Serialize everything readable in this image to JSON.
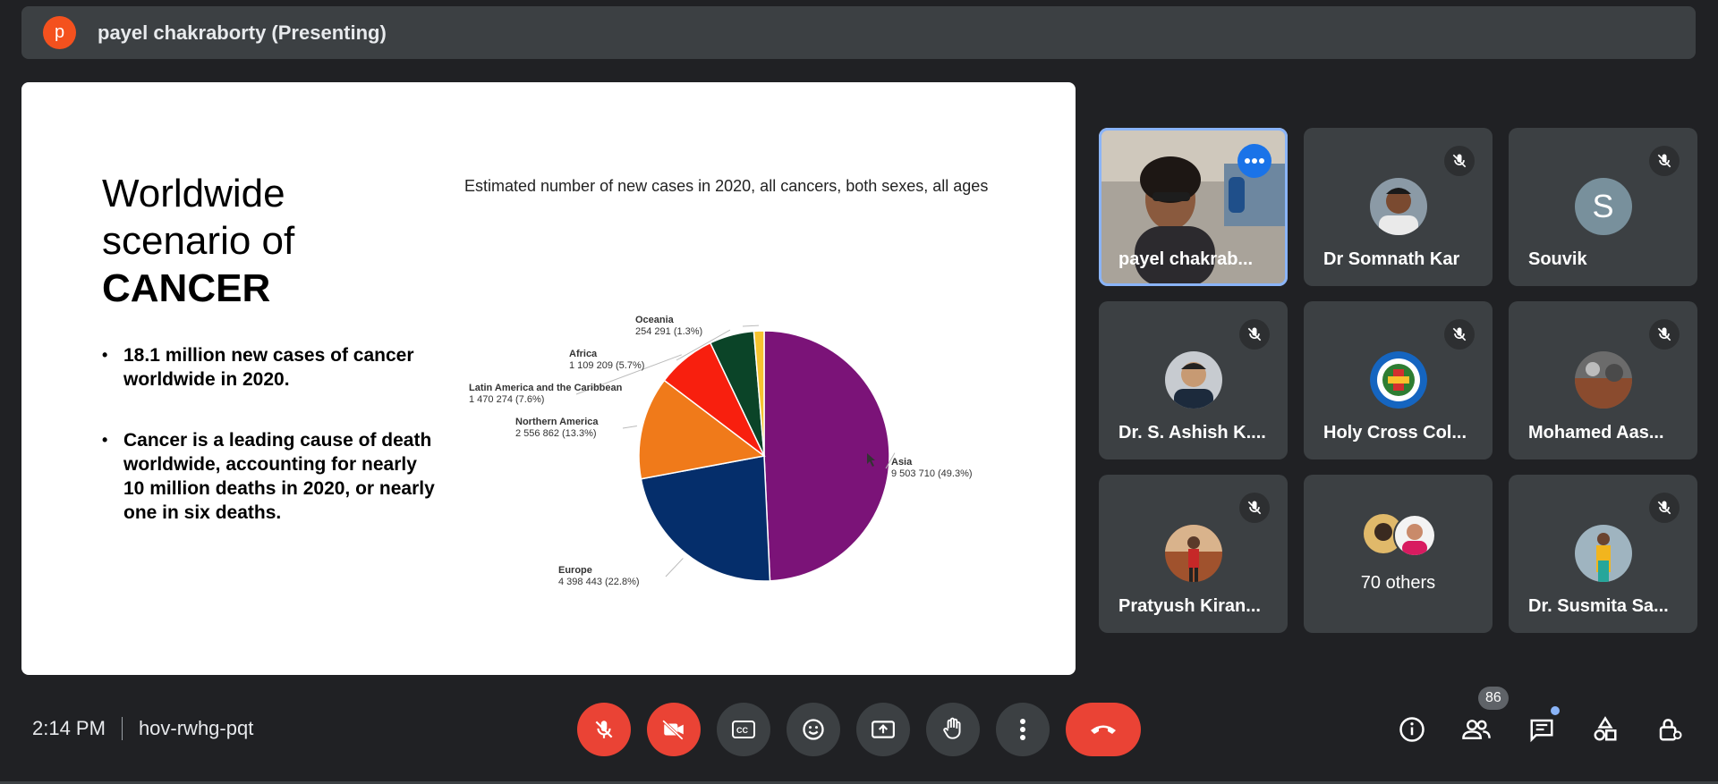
{
  "presenter_bar": {
    "avatar_letter": "p",
    "title": "payel chakraborty (Presenting)"
  },
  "slide": {
    "title_lines": [
      "Worldwide",
      "scenario of",
      "CANCER"
    ],
    "bullets": [
      "18.1 million new cases of cancer worldwide in 2020.",
      "Cancer is a leading cause of death worldwide, accounting for nearly 10 million deaths in 2020, or nearly one in six deaths."
    ]
  },
  "chart_data": {
    "type": "pie",
    "title": "Estimated number of new cases in 2020, all cancers, both sexes, all ages",
    "slices": [
      {
        "name": "Asia",
        "label": "9 503 710 (49.3%)",
        "value": 9503710,
        "percent": 49.3,
        "color": "#7b1378"
      },
      {
        "name": "Europe",
        "label": "4 398 443 (22.8%)",
        "value": 4398443,
        "percent": 22.8,
        "color": "#052e6b"
      },
      {
        "name": "Northern America",
        "label": "2 556 862 (13.3%)",
        "value": 2556862,
        "percent": 13.3,
        "color": "#f07a1a"
      },
      {
        "name": "Latin America and the Caribbean",
        "label": "1 470 274 (7.6%)",
        "value": 1470274,
        "percent": 7.6,
        "color": "#f81f0e"
      },
      {
        "name": "Africa",
        "label": "1 109 209 (5.7%)",
        "value": 1109209,
        "percent": 5.7,
        "color": "#0b4428"
      },
      {
        "name": "Oceania",
        "label": "254 291 (1.3%)",
        "value": 254291,
        "percent": 1.3,
        "color": "#f6c32f"
      }
    ]
  },
  "participants": [
    {
      "name": "payel chakrab...",
      "type": "video",
      "muted": false,
      "active": true
    },
    {
      "name": "Dr Somnath Kar",
      "type": "photo",
      "muted": true
    },
    {
      "name": "Souvik",
      "type": "letter",
      "letter": "S",
      "muted": true
    },
    {
      "name": "Dr. S. Ashish K....",
      "type": "photo",
      "muted": true
    },
    {
      "name": "Holy Cross Col...",
      "type": "photo",
      "muted": true
    },
    {
      "name": "Mohamed Aas...",
      "type": "photo",
      "muted": true
    },
    {
      "name": "Pratyush Kiran...",
      "type": "photo",
      "muted": true
    },
    {
      "name": "70 others",
      "type": "group",
      "muted": false
    },
    {
      "name": "Dr. Susmita Sa...",
      "type": "photo",
      "muted": true
    }
  ],
  "bottom_bar": {
    "time": "2:14 PM",
    "meeting_code": "hov-rwhg-pqt",
    "people_count": "86",
    "controls": [
      "mic-off-icon",
      "camera-off-icon",
      "captions-icon",
      "emoji-icon",
      "present-icon",
      "raise-hand-icon",
      "more-options-icon",
      "end-call-icon"
    ],
    "right_icons": [
      "info-icon",
      "people-icon",
      "chat-icon",
      "activities-icon",
      "host-controls-icon"
    ]
  },
  "colors": {
    "background": "#202124",
    "tile": "#3c4043",
    "accent": "#8ab4f8",
    "red": "#ea4335"
  }
}
